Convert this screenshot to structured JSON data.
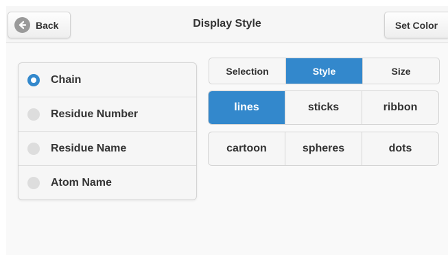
{
  "header": {
    "title": "Display Style",
    "back_label": "Back",
    "set_color_label": "Set Color"
  },
  "selection_list": {
    "selected": "Chain",
    "items": [
      {
        "label": "Chain",
        "selected": true
      },
      {
        "label": "Residue Number",
        "selected": false
      },
      {
        "label": "Residue Name",
        "selected": false
      },
      {
        "label": "Atom Name",
        "selected": false
      }
    ]
  },
  "tabs": {
    "active": "Style",
    "items": [
      {
        "label": "Selection"
      },
      {
        "label": "Style"
      },
      {
        "label": "Size"
      }
    ]
  },
  "styles": {
    "selected": "lines",
    "items": [
      {
        "label": "lines"
      },
      {
        "label": "sticks"
      },
      {
        "label": "ribbon"
      },
      {
        "label": "cartoon"
      },
      {
        "label": "spheres"
      },
      {
        "label": "dots"
      }
    ]
  },
  "colors": {
    "accent": "#3388cc",
    "header_bg": "#f6f6f6",
    "page_bg": "#f9f9f9"
  },
  "icons": {
    "back": "arrow-left-circle-icon",
    "radio_on": "radio-selected-icon",
    "radio_off": "radio-unselected-icon"
  }
}
